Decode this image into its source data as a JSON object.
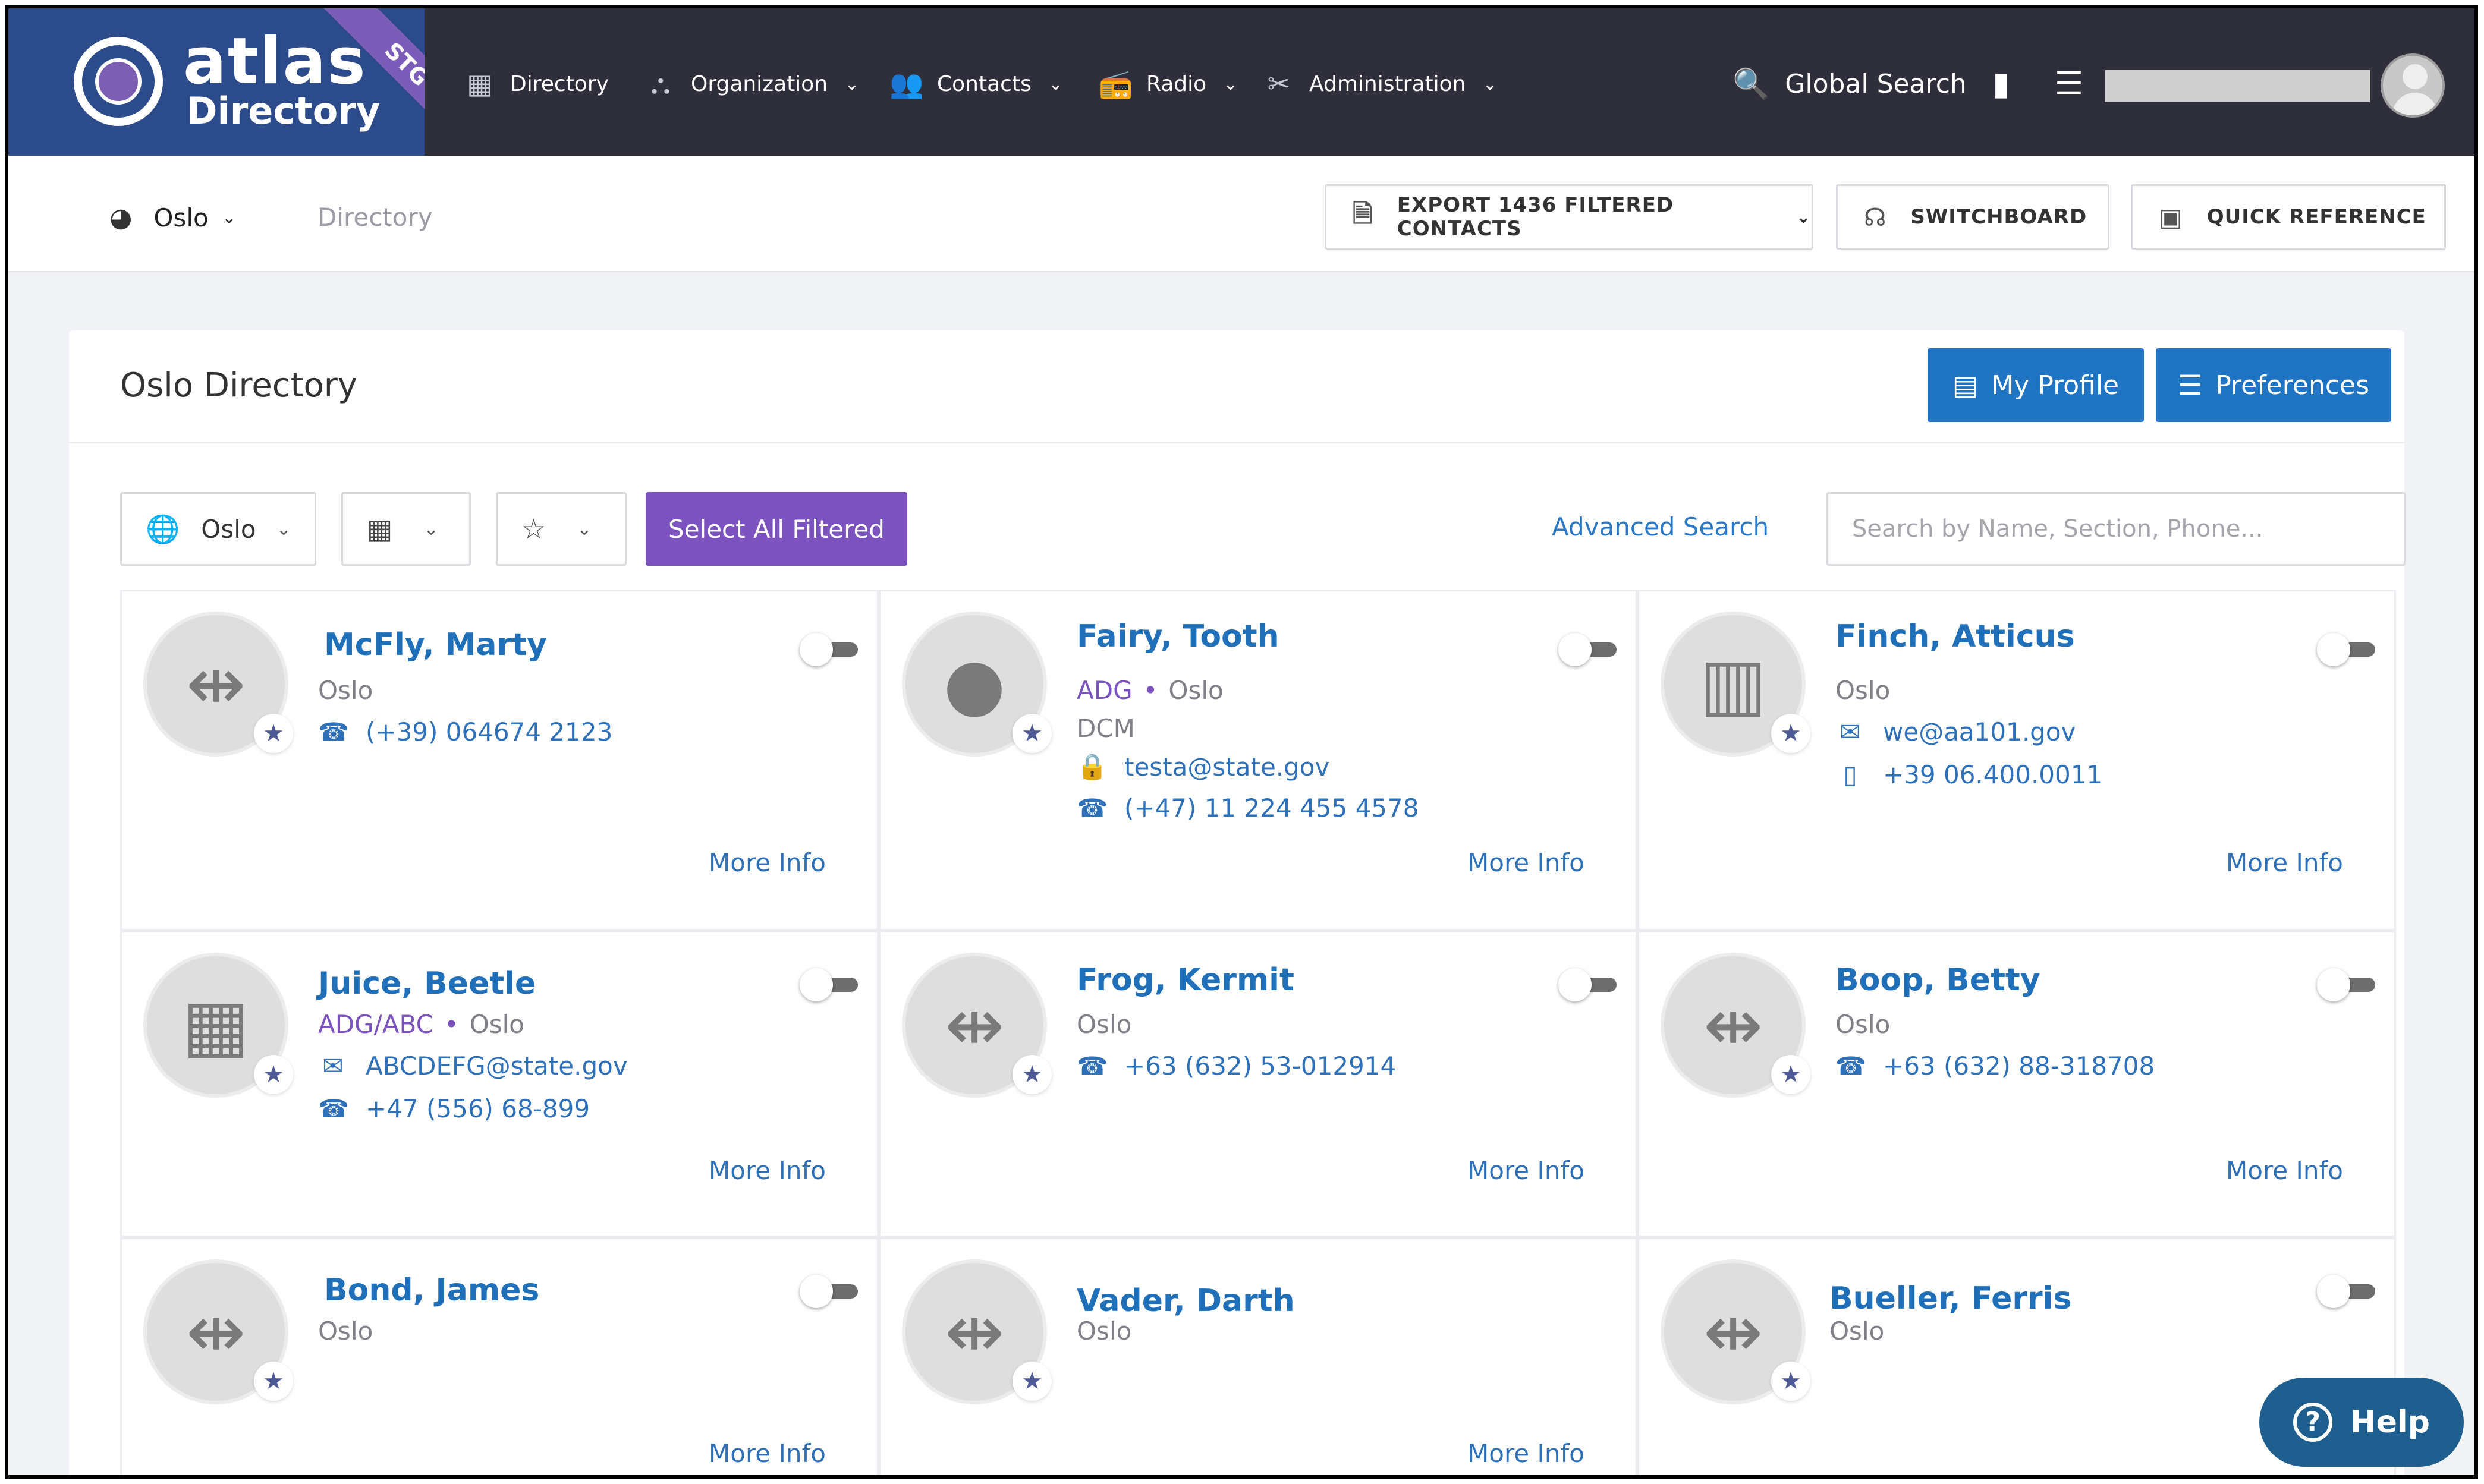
{
  "brand": {
    "name": "atlas",
    "sub": "Directory",
    "env": "STG"
  },
  "nav": {
    "items": [
      {
        "label": "Directory",
        "icon": "directory-icon"
      },
      {
        "label": "Organization",
        "icon": "org-chart-icon"
      },
      {
        "label": "Contacts",
        "icon": "contacts-icon"
      },
      {
        "label": "Radio",
        "icon": "radio-icon"
      },
      {
        "label": "Administration",
        "icon": "tools-icon"
      }
    ],
    "global_search": "Global Search"
  },
  "subbar": {
    "location": "Oslo",
    "breadcrumb": "Directory",
    "export_label": "EXPORT 1436 FILTERED CONTACTS",
    "switchboard_label": "SWITCHBOARD",
    "quick_reference_label": "QUICK REFERENCE"
  },
  "panel": {
    "title": "Oslo Directory",
    "my_profile": "My Profile",
    "preferences": "Preferences",
    "filter_location": "Oslo",
    "select_all": "Select All Filtered",
    "advanced_search": "Advanced Search",
    "search_placeholder": "Search by Name, Section, Phone..."
  },
  "cards": [
    {
      "name": "McFly, Marty",
      "location": "Oslo",
      "org": "",
      "section": "",
      "email": "",
      "lock_email": "",
      "phone": "(+39) 064674 2123",
      "mobile": "",
      "more": "More Info",
      "avatar": "handshake-icon"
    },
    {
      "name": "Fairy, Tooth",
      "location": "Oslo",
      "org": "ADG",
      "section": "DCM",
      "email": "",
      "lock_email": "testa@state.gov",
      "phone": "(+47) 11 224 455 4578",
      "mobile": "",
      "more": "More Info",
      "avatar": "person-icon"
    },
    {
      "name": "Finch, Atticus",
      "location": "Oslo",
      "org": "",
      "section": "",
      "email": "we@aa101.gov",
      "lock_email": "",
      "phone": "",
      "mobile": "+39 06.400.0011",
      "more": "More Info",
      "avatar": "building-icon"
    },
    {
      "name": "Juice, Beetle",
      "location": "Oslo",
      "org": "ADG/ABC",
      "section": "",
      "email": "ABCDEFG@state.gov",
      "lock_email": "",
      "phone": "+47 (556) 68-899",
      "mobile": "",
      "more": "More Info",
      "avatar": "grid-icon"
    },
    {
      "name": "Frog, Kermit",
      "location": "Oslo",
      "org": "",
      "section": "",
      "email": "",
      "lock_email": "",
      "phone": "+63 (632) 53-012914",
      "mobile": "",
      "more": "More Info",
      "avatar": "handshake-icon"
    },
    {
      "name": "Boop, Betty",
      "location": "Oslo",
      "org": "",
      "section": "",
      "email": "",
      "lock_email": "",
      "phone": "+63 (632) 88-318708",
      "mobile": "",
      "more": "More Info",
      "avatar": "handshake-icon"
    },
    {
      "name": "Bond, James",
      "location": "Oslo",
      "org": "",
      "section": "",
      "email": "",
      "lock_email": "",
      "phone": "",
      "mobile": "",
      "more": "More Info",
      "avatar": "handshake-icon"
    },
    {
      "name": "Vader, Darth",
      "location": "Oslo",
      "org": "",
      "section": "",
      "email": "",
      "lock_email": "",
      "phone": "",
      "mobile": "",
      "more": "More Info",
      "avatar": "handshake-icon"
    },
    {
      "name": "Bueller, Ferris",
      "location": "Oslo",
      "org": "",
      "section": "",
      "email": "",
      "lock_email": "",
      "phone": "",
      "mobile": "",
      "more": "Mo",
      "avatar": "handshake-icon"
    }
  ],
  "help": "Help",
  "colors": {
    "navbar": "#2f2f3c",
    "brand": "#2c4b8b",
    "accent_blue": "#1f74c4",
    "accent_purple": "#7b52be",
    "link": "#2e71b8"
  }
}
